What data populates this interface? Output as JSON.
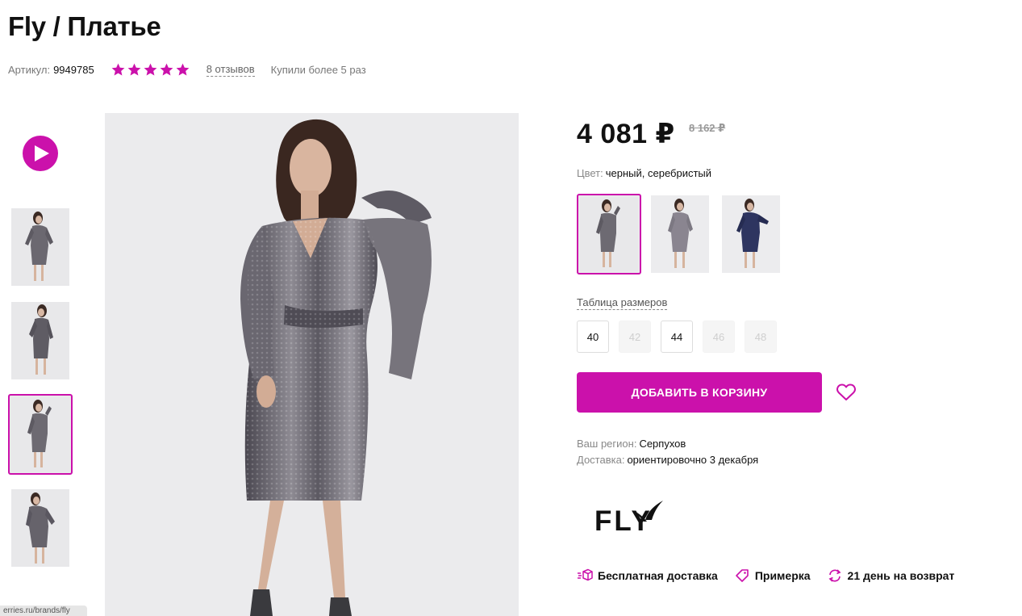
{
  "product": {
    "title": "Fly / Платье",
    "sku_label": "Артикул:",
    "sku_value": "9949785",
    "rating_stars": 5,
    "reviews_link": "8 отзывов",
    "bought": "Купили более 5 раз"
  },
  "colors": {
    "accent": "#cb11ab"
  },
  "gallery": {
    "video_icon": "play-icon",
    "active_thumbnail": 3,
    "url_tooltip": "erries.ru/brands/fly"
  },
  "pricing": {
    "price": "4 081 ₽",
    "old_price": "8 162 ₽"
  },
  "color_selector": {
    "label": "Цвет:",
    "value": "черный, серебристый",
    "active_option": 1
  },
  "sizes": {
    "table_link": "Таблица размеров",
    "options": [
      {
        "label": "40",
        "available": true
      },
      {
        "label": "42",
        "available": false
      },
      {
        "label": "44",
        "available": true
      },
      {
        "label": "46",
        "available": false
      },
      {
        "label": "48",
        "available": false
      }
    ]
  },
  "actions": {
    "add_to_cart": "ДОБАВИТЬ В КОРЗИНУ",
    "favorite_icon": "heart-icon"
  },
  "shipping": {
    "region_label": "Ваш регион:",
    "region_value": "Серпухов",
    "delivery_label": "Доставка:",
    "delivery_value": "ориентировочно 3 декабря"
  },
  "brand": {
    "logo_text": "FLY"
  },
  "features": [
    {
      "icon": "delivery-box-icon",
      "label": "Бесплатная доставка"
    },
    {
      "icon": "tag-icon",
      "label": "Примерка"
    },
    {
      "icon": "return-icon",
      "label": "21 день на возврат"
    }
  ]
}
